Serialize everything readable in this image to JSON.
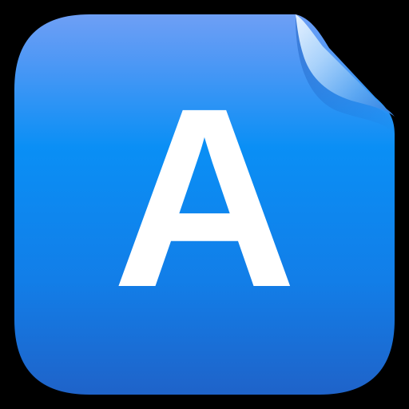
{
  "icon": {
    "letter": "A",
    "colors": {
      "background": "#000000",
      "tile_top": "#6e9ff5",
      "tile_mid": "#0a8ff5",
      "tile_bottom": "#1f63c9",
      "letter": "#ffffff",
      "curl_light": "#d9ecff",
      "curl_mid": "#7fbcf6",
      "curl_dark": "#2f7fe0"
    }
  }
}
